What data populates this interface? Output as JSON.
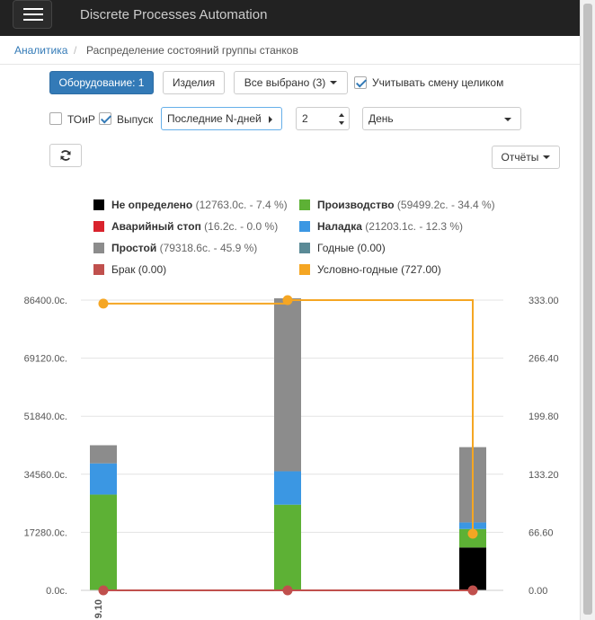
{
  "app": {
    "title": "Discrete Processes Automation"
  },
  "breadcrumb": {
    "root": "Аналитика",
    "separator": "/",
    "current": "Распределение состояний группы станков"
  },
  "toolbar": {
    "equipment_label": "Оборудование: 1",
    "products_label": "Изделия",
    "all_selected_label": "Все выбрано (3)",
    "whole_shift_label": "Учитывать смену целиком",
    "whole_shift_checked": true,
    "toir_label": "ТОиР",
    "toir_checked": false,
    "output_label": "Выпуск",
    "output_checked": true,
    "period_select": "Последние N-дней",
    "n_days_value": "2",
    "granularity_select": "День",
    "refresh_icon": "refresh-icon",
    "reports_label": "Отчёты"
  },
  "legend": [
    {
      "name": "Не определено",
      "extra": "(12763.0с. - 7.4 %)",
      "color": "#000000",
      "bold": true
    },
    {
      "name": "Производство",
      "extra": "(59499.2с. - 34.4 %)",
      "color": "#5db135",
      "bold": true
    },
    {
      "name": "Аварийный стоп",
      "extra": "(16.2с. - 0.0 %)",
      "color": "#d9232d",
      "bold": true
    },
    {
      "name": "Наладка",
      "extra": "(21203.1с. - 12.3 %)",
      "color": "#3b97e3",
      "bold": true
    },
    {
      "name": "Простой",
      "extra": "(79318.6с. - 45.9 %)",
      "color": "#8c8c8c",
      "bold": true
    },
    {
      "name": "Годные (0.00)",
      "extra": "",
      "color": "#5a8a96",
      "bold": false
    },
    {
      "name": "Брак (0.00)",
      "extra": "",
      "color": "#c0504d",
      "bold": false
    },
    {
      "name": "Условно-годные (727.00)",
      "extra": "",
      "color": "#f5a623",
      "bold": false
    }
  ],
  "chart_data": {
    "type": "bar",
    "stacked": true,
    "categories": [
      "9.10",
      "",
      ""
    ],
    "y_left": {
      "ticks": [
        "0.0с.",
        "17280.0с.",
        "34560.0с.",
        "51840.0с.",
        "69120.0с.",
        "86400.0с."
      ],
      "min": 0,
      "max": 86400
    },
    "y_right": {
      "ticks": [
        "0.00",
        "66.60",
        "133.20",
        "199.80",
        "266.40",
        "333.00"
      ],
      "min": 0,
      "max": 333
    },
    "series": [
      {
        "name": "Не определено",
        "color": "#000000",
        "values": [
          0,
          0,
          12763
        ]
      },
      {
        "name": "Производство",
        "color": "#5db135",
        "values": [
          28500,
          25500,
          5499
        ]
      },
      {
        "name": "Наладка",
        "color": "#3b97e3",
        "values": [
          9300,
          9950,
          1953
        ]
      },
      {
        "name": "Простой",
        "color": "#8c8c8c",
        "values": [
          5400,
          51500,
          22418
        ]
      }
    ],
    "lines": [
      {
        "name": "Условно-годные",
        "color": "#f5a623",
        "axis": "right",
        "values": [
          329,
          333,
          65
        ],
        "step": true
      },
      {
        "name": "Брак",
        "color": "#c0504d",
        "axis": "right",
        "values": [
          0,
          0,
          0
        ],
        "step": false
      }
    ],
    "grid": true
  }
}
